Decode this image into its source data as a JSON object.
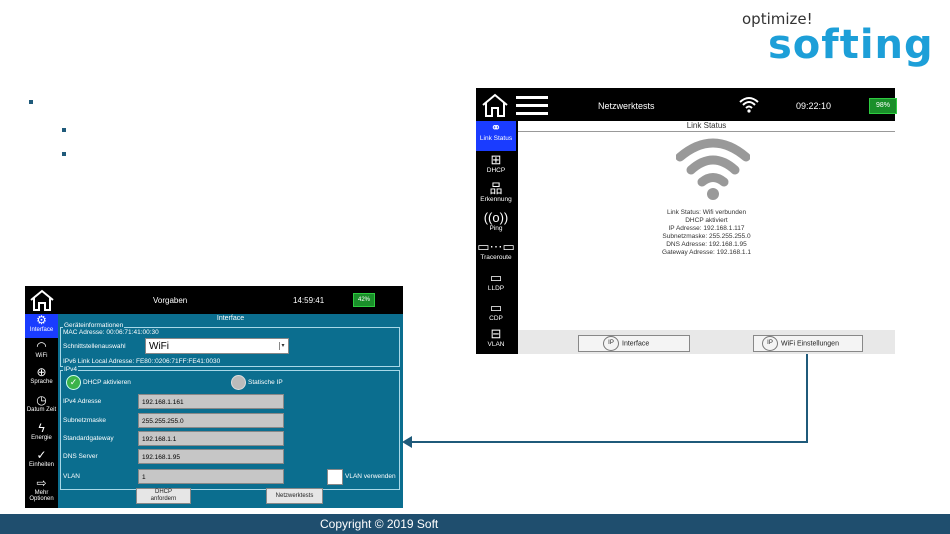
{
  "logo": {
    "tagline": "optimize!",
    "brand": "softing"
  },
  "footer": {
    "copyright": "Copyright © 2019 Soft"
  },
  "right_device": {
    "title": "Netzwerktests",
    "time": "09:22:10",
    "battery": "98%",
    "header": "Link Status",
    "sidebar": [
      {
        "label": "Link Status",
        "icon": "link-icon",
        "active": true
      },
      {
        "label": "DHCP",
        "icon": "dhcp-icon"
      },
      {
        "label": "Erkennung",
        "icon": "network-icon"
      },
      {
        "label": "Ping",
        "icon": "ping-icon"
      },
      {
        "label": "Traceroute",
        "icon": "traceroute-icon"
      },
      {
        "label": "LLDP",
        "icon": "lldp-icon"
      },
      {
        "label": "CDP",
        "icon": "cdp-icon"
      },
      {
        "label": "VLAN",
        "icon": "vlan-icon"
      }
    ],
    "status_lines": [
      "Link Status: Wifi verbunden",
      "DHCP aktiviert",
      "IP Adresse: 192.168.1.117",
      "Subnetzmaske: 255.255.255.0",
      "DNS Adresse: 192.168.1.95",
      "Gateway Adresse: 192.168.1.1"
    ],
    "buttons": {
      "interface": "Interface",
      "wifi": "WiFi Einstellungen"
    }
  },
  "left_device": {
    "title": "Vorgaben",
    "time": "14:59:41",
    "battery": "42%",
    "header": "Interface",
    "sidebar": [
      {
        "label": "Interface",
        "icon": "ip-icon",
        "active": true
      },
      {
        "label": "WiFi",
        "icon": "wifi-icon"
      },
      {
        "label": "Sprache",
        "icon": "globe-icon"
      },
      {
        "label": "Datum Zeit",
        "icon": "clock-icon"
      },
      {
        "label": "Energie",
        "icon": "energy-icon"
      },
      {
        "label": "Einheiten",
        "icon": "check-icon"
      },
      {
        "label": "Mehr Optionen",
        "icon": "arrow-icon"
      }
    ],
    "device_info": {
      "group_title": "Geräteinformationen",
      "mac": "MAC Adresse: 00:06:71:41:00:30",
      "selector_label": "Schnittstellenauswahl",
      "selector_value": "WiFi",
      "ipv6": "IPv6 Link Local Adresse: FE80::0206:71FF:FE41:0030"
    },
    "ipv4": {
      "group_title": "IPv4",
      "dhcp_label": "DHCP aktivieren",
      "static_label": "Statische IP",
      "rows": [
        {
          "label": "IPv4 Adresse",
          "value": "192.168.1.161"
        },
        {
          "label": "Subnetzmaske",
          "value": "255.255.255.0"
        },
        {
          "label": "Standardgateway",
          "value": "192.168.1.1"
        },
        {
          "label": "DNS Server",
          "value": "192.168.1.95"
        },
        {
          "label": "VLAN",
          "value": "1"
        }
      ],
      "vlan_checkbox": "VLAN verwenden"
    },
    "buttons": {
      "dhcp_line1": "DHCP",
      "dhcp_line2": "anfordern",
      "netzwerktests": "Netzwerktests"
    }
  },
  "colors": {
    "accent": "#1a3cff",
    "panel": "#0b6e8f",
    "footer": "#1f4e6e",
    "brand": "#1d9fd8"
  }
}
